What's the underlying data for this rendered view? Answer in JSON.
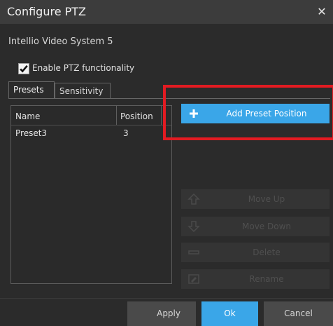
{
  "window": {
    "title": "Configure PTZ",
    "close_icon": "close-icon"
  },
  "system_name": "Intellio Video System 5",
  "enable_ptz": {
    "label": "Enable PTZ functionality",
    "checked": true
  },
  "tabs": [
    {
      "label": "Presets",
      "active": true
    },
    {
      "label": "Sensitivity",
      "active": false
    }
  ],
  "presets_list": {
    "columns": [
      "Name",
      "Position"
    ],
    "rows": [
      {
        "name": "Preset3",
        "position": "3"
      }
    ]
  },
  "actions": {
    "add": {
      "label": "Add Preset Position",
      "icon": "plus-icon"
    },
    "move_up": {
      "label": "Move Up",
      "icon": "arrow-up-icon",
      "enabled": false
    },
    "move_down": {
      "label": "Move Down",
      "icon": "arrow-down-icon",
      "enabled": false
    },
    "delete": {
      "label": "Delete",
      "icon": "minus-icon",
      "enabled": false
    },
    "rename": {
      "label": "Rename",
      "icon": "rename-icon",
      "enabled": false
    }
  },
  "footer": {
    "apply": "Apply",
    "ok": "Ok",
    "cancel": "Cancel"
  },
  "colors": {
    "accent": "#3aa6e8",
    "highlight": "#e21b22",
    "background": "#2b2b2b"
  }
}
